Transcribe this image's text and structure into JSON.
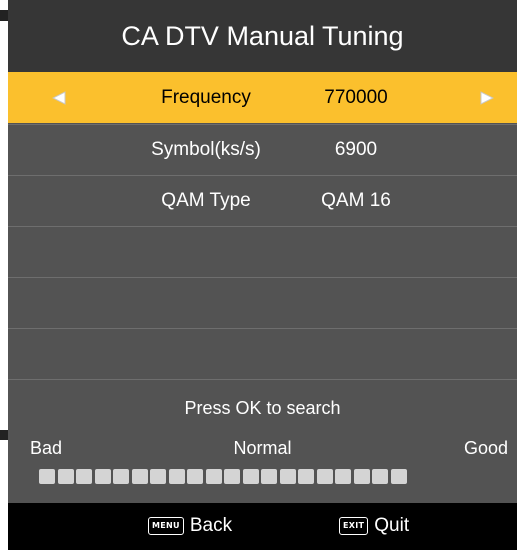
{
  "window": {
    "title": "CA DTV Manual Tuning"
  },
  "rows": [
    {
      "label": "Frequency",
      "value": "770000",
      "selected": true
    },
    {
      "label": "Symbol(ks/s)",
      "value": "6900",
      "selected": false
    },
    {
      "label": "QAM Type",
      "value": "QAM 16",
      "selected": false
    },
    {
      "label": "",
      "value": "",
      "selected": false
    },
    {
      "label": "",
      "value": "",
      "selected": false
    },
    {
      "label": "",
      "value": "",
      "selected": false
    }
  ],
  "icons": {
    "prev": "triangle-left-icon",
    "next": "triangle-right-icon"
  },
  "signal": {
    "prompt": "Press OK to search",
    "bad_label": "Bad",
    "normal_label": "Normal",
    "good_label": "Good",
    "segment_count": 20,
    "filled_segments": 0
  },
  "footer": {
    "back_key": "MENU",
    "back_label": "Back",
    "quit_key": "EXIT",
    "quit_label": "Quit"
  },
  "colors": {
    "highlight": "#fbc02d",
    "panel": "#535353",
    "title_bar": "#363636",
    "footer": "#000000",
    "meter_segment": "#d4d4d4"
  }
}
